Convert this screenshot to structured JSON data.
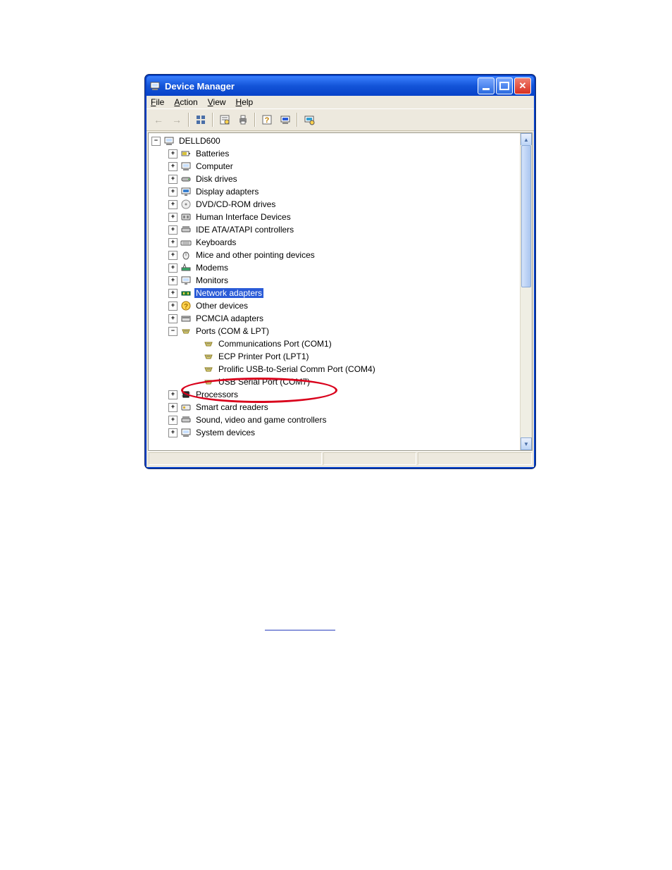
{
  "window": {
    "title": "Device Manager"
  },
  "menubar": {
    "file": "File",
    "action": "Action",
    "view": "View",
    "help": "Help"
  },
  "toolbar_icons": {
    "back": "back-arrow-icon",
    "forward": "forward-arrow-icon",
    "up": "view-icon",
    "properties": "properties-icon",
    "print": "print-icon",
    "help": "help-icon",
    "scan": "scan-icon",
    "extra": "monitor-icon"
  },
  "tree": {
    "root": "DELLD600",
    "nodes": [
      {
        "label": "Batteries",
        "exp": "+"
      },
      {
        "label": "Computer",
        "exp": "+"
      },
      {
        "label": "Disk drives",
        "exp": "+"
      },
      {
        "label": "Display adapters",
        "exp": "+"
      },
      {
        "label": "DVD/CD-ROM drives",
        "exp": "+"
      },
      {
        "label": "Human Interface Devices",
        "exp": "+"
      },
      {
        "label": "IDE ATA/ATAPI controllers",
        "exp": "+"
      },
      {
        "label": "Keyboards",
        "exp": "+"
      },
      {
        "label": "Mice and other pointing devices",
        "exp": "+"
      },
      {
        "label": "Modems",
        "exp": "+"
      },
      {
        "label": "Monitors",
        "exp": "+"
      },
      {
        "label": "Network adapters",
        "exp": "+",
        "selected": true
      },
      {
        "label": "Other devices",
        "exp": "+"
      },
      {
        "label": "PCMCIA adapters",
        "exp": "+"
      },
      {
        "label": "Ports (COM & LPT)",
        "exp": "-",
        "children": [
          {
            "label": "Communications Port (COM1)"
          },
          {
            "label": "ECP Printer Port (LPT1)"
          },
          {
            "label": "Prolific USB-to-Serial Comm Port (COM4)"
          },
          {
            "label": "USB Serial Port (COM7)",
            "circled": true
          }
        ]
      },
      {
        "label": "Processors",
        "exp": "+"
      },
      {
        "label": "Smart card readers",
        "exp": "+"
      },
      {
        "label": "Sound, video and game controllers",
        "exp": "+"
      },
      {
        "label": "System devices",
        "exp": "+"
      }
    ]
  },
  "scrollbar": {
    "up": "▲",
    "down": "▼"
  }
}
